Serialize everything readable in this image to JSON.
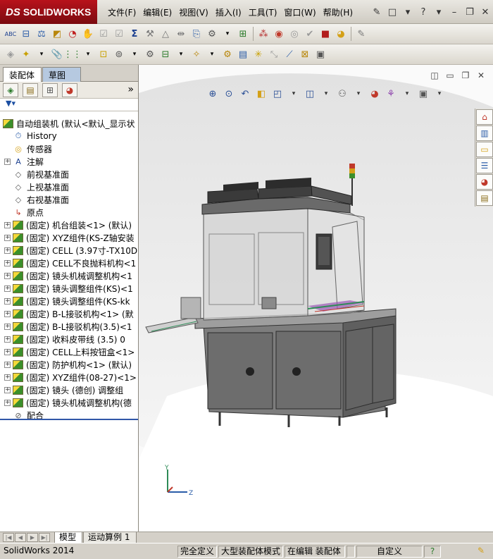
{
  "app": {
    "logo_prefix": "DS",
    "logo_text": "SOLIDWORKS"
  },
  "menu": [
    "文件(F)",
    "编辑(E)",
    "视图(V)",
    "插入(I)",
    "工具(T)",
    "窗口(W)",
    "帮助(H)"
  ],
  "panel": {
    "tabs": [
      "装配体",
      "草图"
    ],
    "collapse_symbol": "»",
    "tree_root": "自动组装机 (默认<默认_显示状",
    "tree_items": [
      {
        "label": "History",
        "icon": "history-icon",
        "expandable": false
      },
      {
        "label": "传感器",
        "icon": "sensor-icon",
        "expandable": false
      },
      {
        "label": "注解",
        "icon": "annotation-icon",
        "expandable": true
      },
      {
        "label": "前视基准面",
        "icon": "plane-icon",
        "expandable": false
      },
      {
        "label": "上视基准面",
        "icon": "plane-icon",
        "expandable": false
      },
      {
        "label": "右视基准面",
        "icon": "plane-icon",
        "expandable": false
      },
      {
        "label": "原点",
        "icon": "origin-icon",
        "expandable": false
      },
      {
        "label": "(固定) 机台组装<1> (默认)",
        "icon": "part-icon",
        "expandable": true
      },
      {
        "label": "(固定) XYZ组件(KS-Z轴安装",
        "icon": "part-icon",
        "expandable": true
      },
      {
        "label": "(固定) CELL (3.97寸-TX10D",
        "icon": "part-icon",
        "expandable": true
      },
      {
        "label": "(固定) CELL不良抛料机构<1",
        "icon": "part-icon",
        "expandable": true
      },
      {
        "label": "(固定) 镜头机械调整机构<1",
        "icon": "part-icon",
        "expandable": true
      },
      {
        "label": "(固定) 镜头调整组件(KS)<1",
        "icon": "part-icon",
        "expandable": true
      },
      {
        "label": "(固定) 镜头调整组件(KS-kk",
        "icon": "part-icon",
        "expandable": true
      },
      {
        "label": "(固定) B-L接驳机构<1> (默",
        "icon": "part-icon",
        "expandable": true
      },
      {
        "label": "(固定) B-L接驳机构(3.5)<1",
        "icon": "part-icon",
        "expandable": true
      },
      {
        "label": "(固定) 收料皮带线 (3.5) 0",
        "icon": "part-icon",
        "expandable": true
      },
      {
        "label": "(固定) CELL上料按钮盒<1>",
        "icon": "part-icon",
        "expandable": true
      },
      {
        "label": "(固定) 防护机构<1> (默认)",
        "icon": "part-icon",
        "expandable": true
      },
      {
        "label": "(固定) XYZ组件(08-27)<1>",
        "icon": "part-icon",
        "expandable": true
      },
      {
        "label": "(固定) 镜头 (德创) 调整组",
        "icon": "part-icon",
        "expandable": true
      },
      {
        "label": "(固定) 镜头机械调整机构(德",
        "icon": "part-icon",
        "expandable": true
      },
      {
        "label": "配合",
        "icon": "mates-icon",
        "expandable": false
      }
    ]
  },
  "viewport": {
    "triad_y": "Y",
    "triad_z": "Z"
  },
  "bottom_tabs": [
    "模型",
    "运动算例 1"
  ],
  "status": {
    "app_version": "SolidWorks 2014",
    "define": "完全定义",
    "mode": "大型装配体模式",
    "editing": "在编辑 装配体",
    "custom": "自定义"
  },
  "colors": {
    "logo_red": "#a3121a",
    "selection_blue": "#3057a8",
    "sketch_tab": "#b6c9e0"
  }
}
